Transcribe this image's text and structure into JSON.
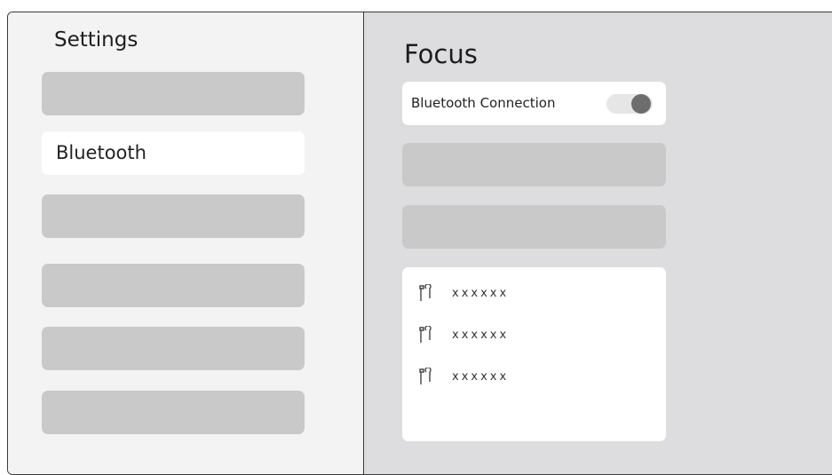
{
  "sidebar": {
    "title": "Settings",
    "items": [
      {
        "label": ""
      },
      {
        "label": "Bluetooth"
      },
      {
        "label": ""
      },
      {
        "label": ""
      },
      {
        "label": ""
      },
      {
        "label": ""
      }
    ]
  },
  "main": {
    "heading": "Focus",
    "bluetooth_connection_label": "Bluetooth Connection",
    "bluetooth_enabled": true,
    "devices": [
      {
        "icon": "earbuds-icon",
        "name": "xxxxxx"
      },
      {
        "icon": "earbuds-icon",
        "name": "xxxxxx"
      },
      {
        "icon": "earbuds-icon",
        "name": "xxxxxx"
      }
    ]
  }
}
